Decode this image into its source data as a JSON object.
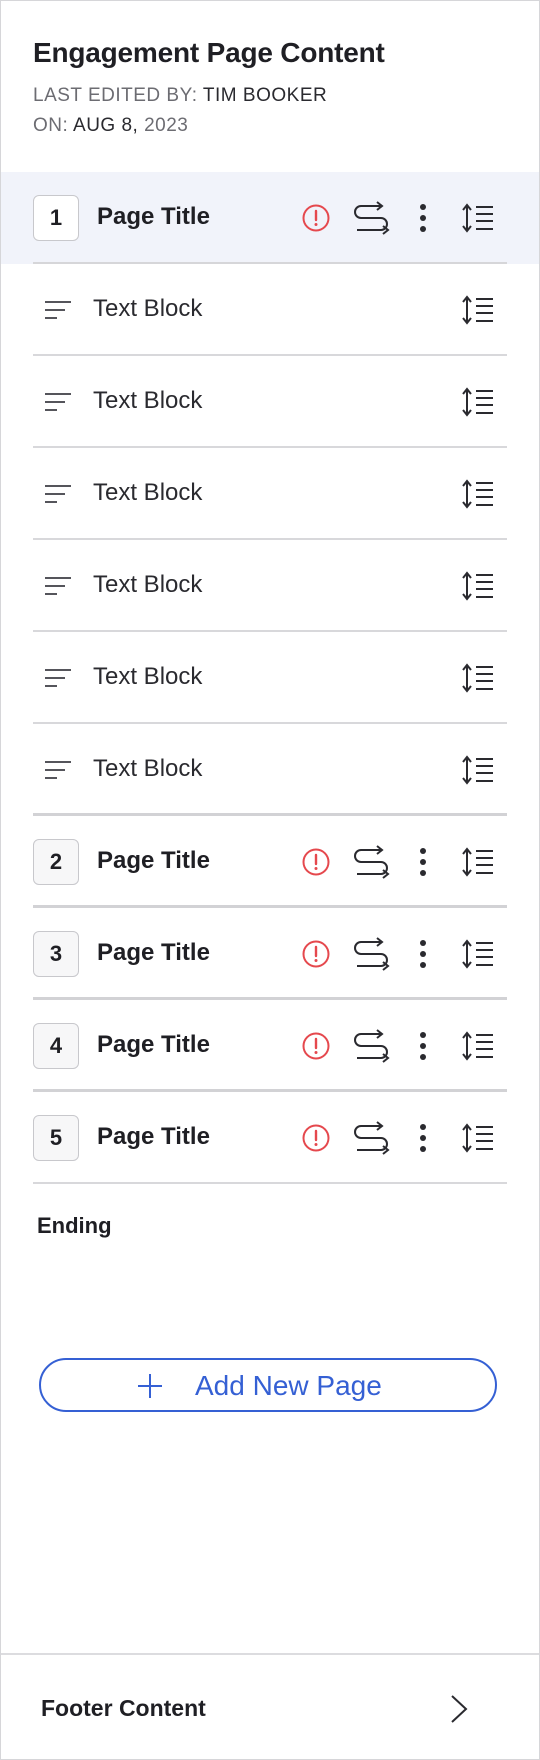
{
  "header": {
    "title": "Engagement Page Content",
    "last_edited_label": "LAST EDITED BY:",
    "last_edited_value": "TIM BOOKER",
    "on_label": "ON:",
    "on_value": "AUG 8,",
    "on_year": "2023"
  },
  "pages": [
    {
      "number": "1",
      "title": "Page Title",
      "active": true
    },
    {
      "number": "2",
      "title": "Page Title",
      "active": false
    },
    {
      "number": "3",
      "title": "Page Title",
      "active": false
    },
    {
      "number": "4",
      "title": "Page Title",
      "active": false
    },
    {
      "number": "5",
      "title": "Page Title",
      "active": false
    }
  ],
  "blocks": [
    {
      "label": "Text Block"
    },
    {
      "label": "Text Block"
    },
    {
      "label": "Text Block"
    },
    {
      "label": "Text Block"
    },
    {
      "label": "Text Block"
    },
    {
      "label": "Text Block"
    }
  ],
  "ending": {
    "label": "Ending"
  },
  "add_page": {
    "label": "Add New Page"
  },
  "footer": {
    "label": "Footer Content"
  },
  "colors": {
    "accent": "#3560d4",
    "warning": "#e5484d",
    "active_row": "#f1f3fa"
  },
  "icons": {
    "warning": "warning-icon",
    "route": "route-icon",
    "kebab": "kebab-menu-icon",
    "reorder": "reorder-icon",
    "text": "text-lines-icon",
    "plus": "plus-icon",
    "chevron": "chevron-right-icon"
  }
}
